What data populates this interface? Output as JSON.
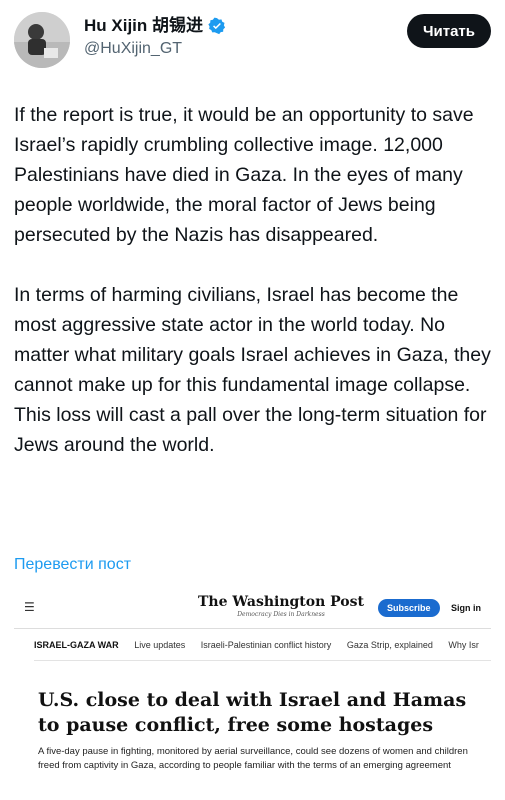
{
  "author": {
    "display_name": "Hu Xijin 胡锡进",
    "handle": "@HuXijin_GT",
    "verified": true
  },
  "actions": {
    "read_label": "Читать"
  },
  "tweet": {
    "paragraphs": [
      "If the report is true, it would be an opportunity to save Israel’s rapidly crumbling collective image. 12,000 Palestinians have died in Gaza. In the eyes of many people worldwide, the moral factor of Jews being persecuted by the Nazis has disappeared.",
      "In terms of harming civilians, Israel has become the most aggressive state actor in the world today. No matter what military goals Israel achieves in Gaza, they cannot make up for this fundamental image collapse. This loss will cast a pall over the long-term situation for Jews around the world."
    ],
    "translate_label": "Перевести пост"
  },
  "card": {
    "logo": "The Washington Post",
    "tagline": "Democracy Dies in Darkness",
    "subscribe_label": "Subscribe",
    "signin_label": "Sign in",
    "nav": [
      "ISRAEL-GAZA WAR",
      "Live updates",
      "Israeli-Palestinian conflict history",
      "Gaza Strip, explained",
      "Why Isr"
    ],
    "headline": "U.S. close to deal with Israel and Hamas to pause conflict, free some hostages",
    "deck": "A five-day pause in fighting, monitored by aerial surveillance, could see dozens of women and children freed from captivity in Gaza, according to people familiar with the terms of an emerging agreement"
  },
  "colors": {
    "verified_blue": "#1d9bf0",
    "link_blue": "#1d9bf0",
    "subscribe_blue": "#1a6bcf"
  }
}
